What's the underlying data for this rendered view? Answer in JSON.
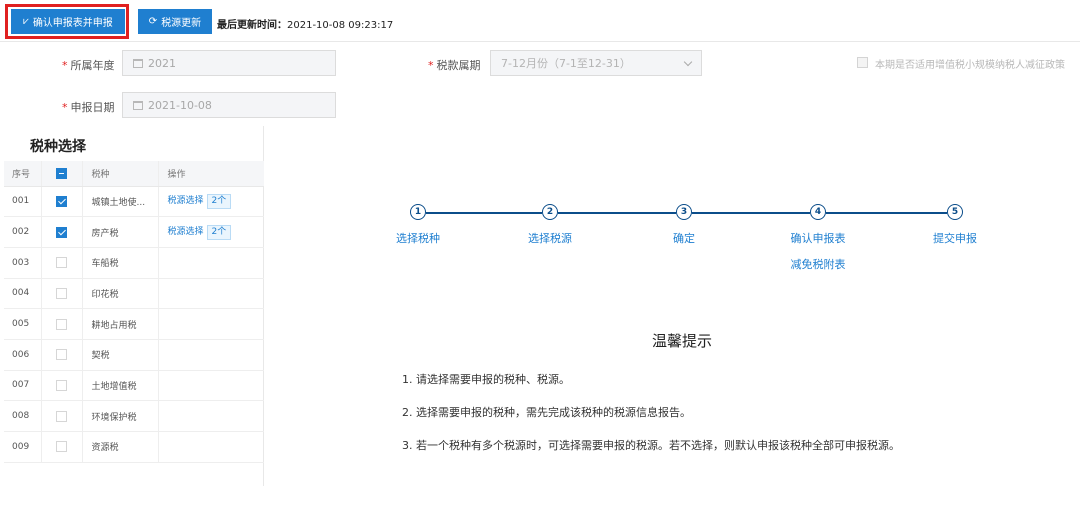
{
  "toolbar": {
    "confirm_button": "确认申报表并申报",
    "refresh_button": "税源更新",
    "update_label": "最后更新时间：",
    "update_value": "2021-10-08 09:23:17"
  },
  "form": {
    "year_label": "所属年度",
    "year_value": "2021",
    "period_label": "税款属期",
    "period_value": "7-12月份（7-1至12-31）",
    "declare_date_label": "申报日期",
    "declare_date_value": "2021-10-08",
    "small_taxpayer_label": "本期是否适用增值税小规模纳税人减征政策"
  },
  "tax_panel": {
    "title": "税种选择",
    "columns": [
      "序号",
      "",
      "税种",
      "操作"
    ],
    "rows": [
      {
        "no": "001",
        "checked": true,
        "name": "城镇土地使...",
        "op_link": "税源选择",
        "op_badge": "2个"
      },
      {
        "no": "002",
        "checked": true,
        "name": "房产税",
        "op_link": "税源选择",
        "op_badge": "2个"
      },
      {
        "no": "003",
        "checked": false,
        "name": "车船税",
        "op_link": "",
        "op_badge": ""
      },
      {
        "no": "004",
        "checked": false,
        "name": "印花税",
        "op_link": "",
        "op_badge": ""
      },
      {
        "no": "005",
        "checked": false,
        "name": "耕地占用税",
        "op_link": "",
        "op_badge": ""
      },
      {
        "no": "006",
        "checked": false,
        "name": "契税",
        "op_link": "",
        "op_badge": ""
      },
      {
        "no": "007",
        "checked": false,
        "name": "土地增值税",
        "op_link": "",
        "op_badge": ""
      },
      {
        "no": "008",
        "checked": false,
        "name": "环境保护税",
        "op_link": "",
        "op_badge": ""
      },
      {
        "no": "009",
        "checked": false,
        "name": "资源税",
        "op_link": "",
        "op_badge": ""
      }
    ]
  },
  "steps": [
    {
      "num": "1",
      "label": "选择税种",
      "sub": ""
    },
    {
      "num": "2",
      "label": "选择税源",
      "sub": ""
    },
    {
      "num": "3",
      "label": "确定",
      "sub": ""
    },
    {
      "num": "4",
      "label": "确认申报表",
      "sub": "减免税附表"
    },
    {
      "num": "5",
      "label": "提交申报",
      "sub": ""
    }
  ],
  "tips": {
    "title": "温馨提示",
    "items": [
      "1. 请选择需要申报的税种、税源。",
      "2. 选择需要申报的税种，需先完成该税种的税源信息报告。",
      "3. 若一个税种有多个税源时，可选择需要申报的税源。若不选择，则默认申报该税种全部可申报税源。"
    ]
  },
  "colors": {
    "primary": "#1f7fd0",
    "step_dark": "#0b4d8a",
    "highlight_frame": "#e02020"
  },
  "icons": {
    "confirm": "send-icon",
    "refresh": "refresh-icon",
    "calendar": "calendar-icon",
    "dropdown": "chevron-down-icon"
  }
}
